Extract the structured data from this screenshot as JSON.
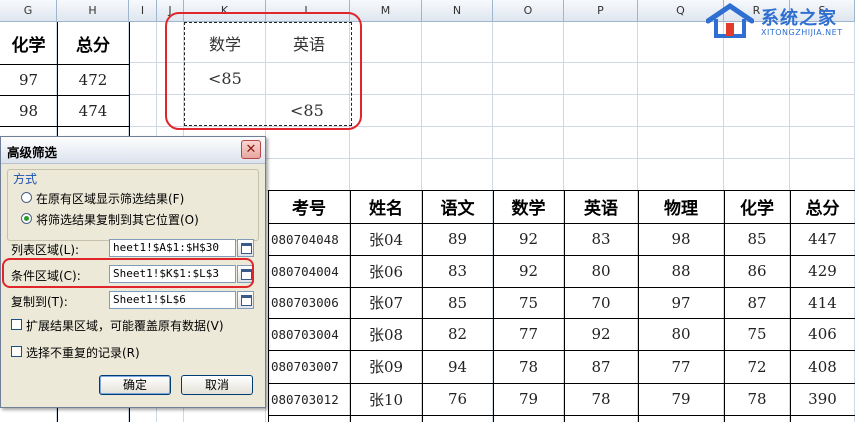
{
  "columns": [
    "G",
    "H",
    "I",
    "J",
    "K",
    "L",
    "M",
    "N",
    "O",
    "P",
    "Q",
    "R",
    "S"
  ],
  "left_table": {
    "headers": [
      "化学",
      "总分"
    ],
    "rows": [
      [
        "97",
        "472"
      ],
      [
        "98",
        "474"
      ]
    ]
  },
  "criteria": {
    "headers": [
      "数学",
      "英语"
    ],
    "row1": [
      "<85",
      ""
    ],
    "row2": [
      "",
      "<85"
    ]
  },
  "result_table": {
    "headers": [
      "考号",
      "姓名",
      "语文",
      "数学",
      "英语",
      "物理",
      "化学",
      "总分"
    ],
    "rows": [
      [
        "080704048",
        "张04",
        "89",
        "92",
        "83",
        "98",
        "85",
        "447"
      ],
      [
        "080704004",
        "张06",
        "83",
        "92",
        "80",
        "88",
        "86",
        "429"
      ],
      [
        "080703006",
        "张07",
        "85",
        "75",
        "70",
        "97",
        "87",
        "414"
      ],
      [
        "080703004",
        "张08",
        "82",
        "77",
        "92",
        "80",
        "75",
        "406"
      ],
      [
        "080703007",
        "张09",
        "94",
        "78",
        "87",
        "77",
        "72",
        "408"
      ],
      [
        "080703012",
        "张10",
        "76",
        "79",
        "78",
        "79",
        "78",
        "390"
      ]
    ]
  },
  "dialog": {
    "title": "高级筛选",
    "close": "✕",
    "mode_label": "方式",
    "option_in_place": "在原有区域显示筛选结果(F)",
    "option_copy": "将筛选结果复制到其它位置(O)",
    "list_range_label": "列表区域(L):",
    "list_range_value": "heet1!$A$1:$H$30",
    "criteria_range_label": "条件区域(C):",
    "criteria_range_value": "Sheet1!$K$1:$L$3",
    "copy_to_label": "复制到(T):",
    "copy_to_value": "Sheet1!$L$6",
    "expand_label": "扩展结果区域，可能覆盖原有数据(V)",
    "unique_label": "选择不重复的记录(R)",
    "ok": "确定",
    "cancel": "取消"
  },
  "watermark": {
    "brand": "系统之家",
    "url": "XITONGZHIJIA.NET"
  },
  "colors": {
    "highlight_red": "#e0262b",
    "dialog_bg": "#ece9d8",
    "grid": "#d0d7e5",
    "header_bg": "#dfe6ef"
  }
}
